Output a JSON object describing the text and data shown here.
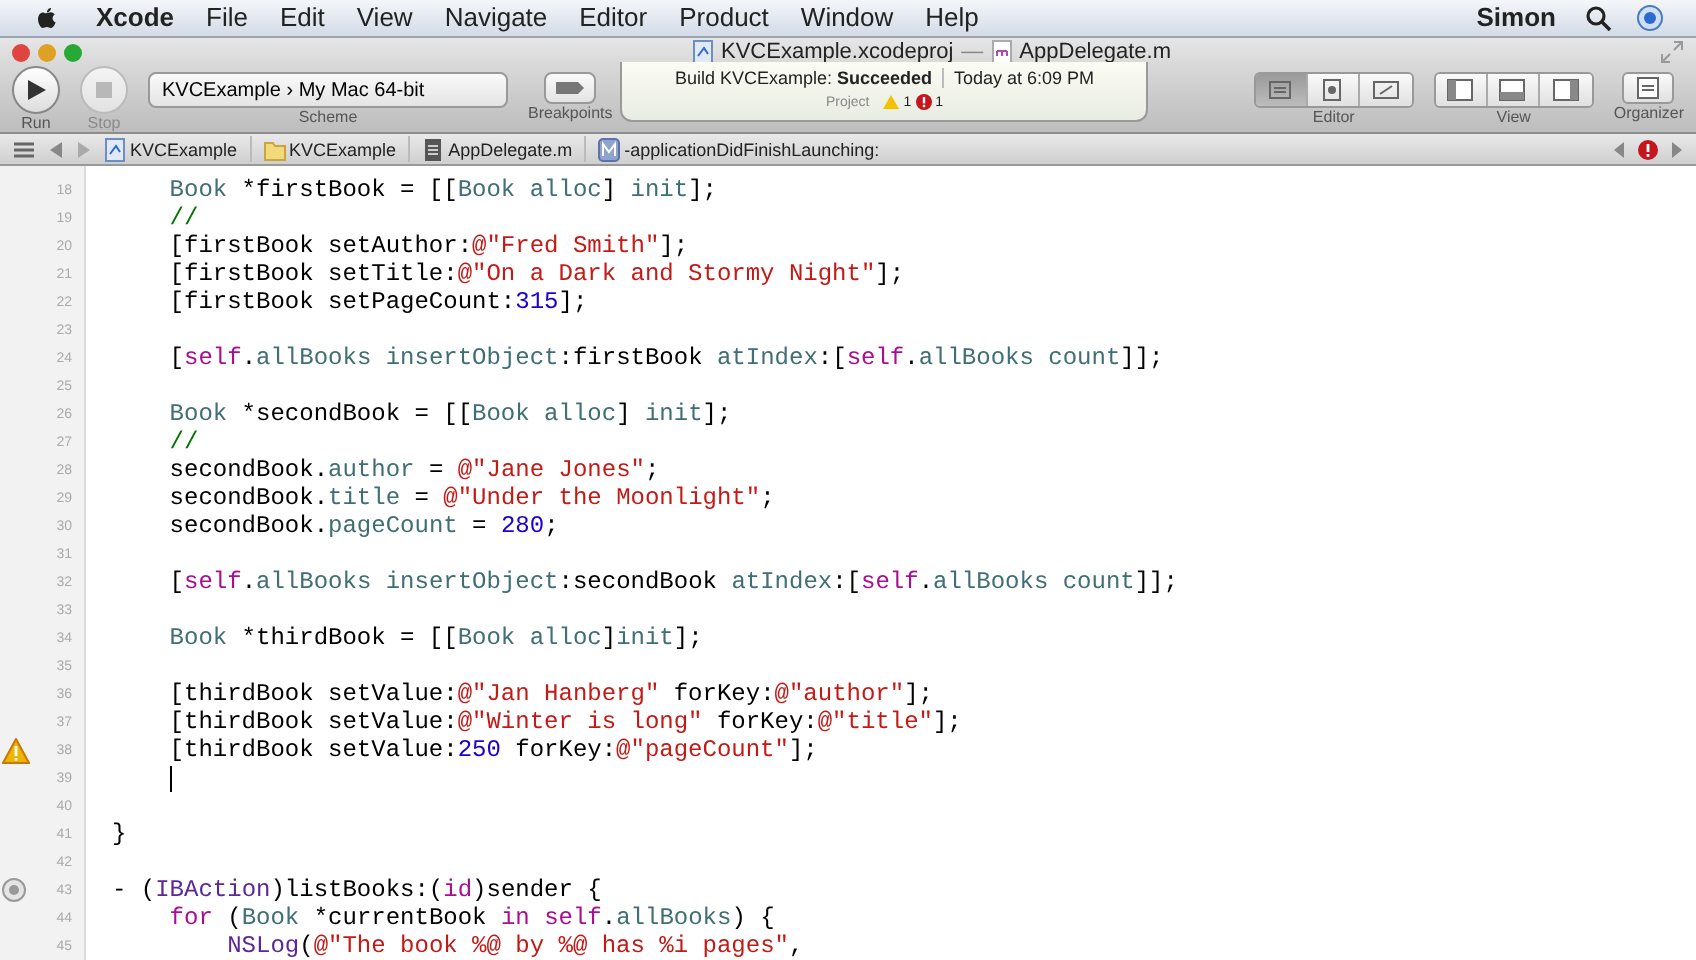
{
  "menu_bar": {
    "items": [
      {
        "label": "Xcode",
        "kind": "app"
      },
      {
        "label": "File",
        "kind": "menu"
      },
      {
        "label": "Edit",
        "kind": "menu"
      },
      {
        "label": "View",
        "kind": "menu"
      },
      {
        "label": "Navigate",
        "kind": "menu"
      },
      {
        "label": "Editor",
        "kind": "menu"
      },
      {
        "label": "Product",
        "kind": "menu"
      },
      {
        "label": "Window",
        "kind": "menu"
      },
      {
        "label": "Help",
        "kind": "menu"
      }
    ],
    "user": "Simon"
  },
  "window": {
    "title_project": "KVCExample.xcodeproj",
    "title_separator": "—",
    "title_file": "AppDelegate.m"
  },
  "toolbar": {
    "run": {
      "label": "Run",
      "disabled": false
    },
    "stop": {
      "label": "Stop",
      "disabled": true
    },
    "scheme": {
      "target": "KVCExample",
      "separator": "›",
      "destination": "My Mac 64-bit",
      "label": "Scheme"
    },
    "breakpoints": {
      "label": "Breakpoints"
    },
    "activity": {
      "prefix": "Build KVCExample:",
      "result": "Succeeded",
      "time": "Today at 6:09 PM",
      "project": "Project",
      "warnings": "1",
      "errors": "1"
    },
    "editor": {
      "label": "Editor",
      "segments": [
        {
          "selected": true
        },
        {
          "selected": false
        },
        {
          "selected": false
        }
      ]
    },
    "view": {
      "label": "View"
    },
    "organizer": {
      "label": "Organizer"
    }
  },
  "jump_bar": {
    "path": [
      {
        "label": "KVCExample",
        "kind": "project"
      },
      {
        "label": "KVCExample",
        "kind": "folder"
      },
      {
        "label": "AppDelegate.m",
        "kind": "file"
      },
      {
        "label": "-applicationDidFinishLaunching:",
        "kind": "method"
      }
    ]
  },
  "code": {
    "lines": [
      {
        "number": "18",
        "warning": false,
        "breakpoint": false,
        "caret": false,
        "tokens": [
          {
            "kind": "project",
            "text": "    Book"
          },
          {
            "kind": "plain",
            "text": " *firstBook = [["
          },
          {
            "kind": "project",
            "text": "Book"
          },
          {
            "kind": "project",
            "text": " alloc"
          },
          {
            "kind": "plain",
            "text": "] "
          },
          {
            "kind": "project",
            "text": "init"
          },
          {
            "kind": "plain",
            "text": "];"
          }
        ]
      },
      {
        "number": "19",
        "warning": false,
        "breakpoint": false,
        "caret": false,
        "tokens": [
          {
            "kind": "comment",
            "text": "    //"
          }
        ]
      },
      {
        "number": "20",
        "warning": false,
        "breakpoint": false,
        "caret": false,
        "tokens": [
          {
            "kind": "plain",
            "text": "    [firstBook setAuthor:"
          },
          {
            "kind": "string",
            "text": "@\"Fred Smith\""
          },
          {
            "kind": "plain",
            "text": "];"
          }
        ]
      },
      {
        "number": "21",
        "warning": false,
        "breakpoint": false,
        "caret": false,
        "tokens": [
          {
            "kind": "plain",
            "text": "    [firstBook setTitle:"
          },
          {
            "kind": "string",
            "text": "@\"On a Dark and Stormy Night\""
          },
          {
            "kind": "plain",
            "text": "];"
          }
        ]
      },
      {
        "number": "22",
        "warning": false,
        "breakpoint": false,
        "caret": false,
        "tokens": [
          {
            "kind": "plain",
            "text": "    [firstBook setPageCount:"
          },
          {
            "kind": "number",
            "text": "315"
          },
          {
            "kind": "plain",
            "text": "];"
          }
        ]
      },
      {
        "number": "23",
        "warning": false,
        "breakpoint": false,
        "caret": false
      },
      {
        "number": "24",
        "warning": false,
        "breakpoint": false,
        "caret": false,
        "tokens": [
          {
            "kind": "plain",
            "text": "    ["
          },
          {
            "kind": "keyword",
            "text": "self"
          },
          {
            "kind": "plain",
            "text": "."
          },
          {
            "kind": "project",
            "text": "allBooks"
          },
          {
            "kind": "project",
            "text": " insertObject"
          },
          {
            "kind": "plain",
            "text": ":firstBook "
          },
          {
            "kind": "project",
            "text": "atIndex"
          },
          {
            "kind": "plain",
            "text": ":["
          },
          {
            "kind": "keyword",
            "text": "self"
          },
          {
            "kind": "plain",
            "text": "."
          },
          {
            "kind": "project",
            "text": "allBooks"
          },
          {
            "kind": "project",
            "text": " count"
          },
          {
            "kind": "plain",
            "text": "]];"
          }
        ]
      },
      {
        "number": "25",
        "warning": false,
        "breakpoint": false,
        "caret": false
      },
      {
        "number": "26",
        "warning": false,
        "breakpoint": false,
        "caret": false,
        "tokens": [
          {
            "kind": "project",
            "text": "    Book"
          },
          {
            "kind": "plain",
            "text": " *secondBook = [["
          },
          {
            "kind": "project",
            "text": "Book"
          },
          {
            "kind": "project",
            "text": " alloc"
          },
          {
            "kind": "plain",
            "text": "] "
          },
          {
            "kind": "project",
            "text": "init"
          },
          {
            "kind": "plain",
            "text": "];"
          }
        ]
      },
      {
        "number": "27",
        "warning": false,
        "breakpoint": false,
        "caret": false,
        "tokens": [
          {
            "kind": "comment",
            "text": "    //"
          }
        ]
      },
      {
        "number": "28",
        "warning": false,
        "breakpoint": false,
        "caret": false,
        "tokens": [
          {
            "kind": "plain",
            "text": "    secondBook."
          },
          {
            "kind": "project",
            "text": "author"
          },
          {
            "kind": "plain",
            "text": " = "
          },
          {
            "kind": "string",
            "text": "@\"Jane Jones\""
          },
          {
            "kind": "plain",
            "text": ";"
          }
        ]
      },
      {
        "number": "29",
        "warning": false,
        "breakpoint": false,
        "caret": false,
        "tokens": [
          {
            "kind": "plain",
            "text": "    secondBook."
          },
          {
            "kind": "project",
            "text": "title"
          },
          {
            "kind": "plain",
            "text": " = "
          },
          {
            "kind": "string",
            "text": "@\"Under the Moonlight\""
          },
          {
            "kind": "plain",
            "text": ";"
          }
        ]
      },
      {
        "number": "30",
        "warning": false,
        "breakpoint": false,
        "caret": false,
        "tokens": [
          {
            "kind": "plain",
            "text": "    secondBook."
          },
          {
            "kind": "project",
            "text": "pageCount"
          },
          {
            "kind": "plain",
            "text": " = "
          },
          {
            "kind": "number",
            "text": "280"
          },
          {
            "kind": "plain",
            "text": ";"
          }
        ]
      },
      {
        "number": "31",
        "warning": false,
        "breakpoint": false,
        "caret": false
      },
      {
        "number": "32",
        "warning": false,
        "breakpoint": false,
        "caret": false,
        "tokens": [
          {
            "kind": "plain",
            "text": "    ["
          },
          {
            "kind": "keyword",
            "text": "self"
          },
          {
            "kind": "plain",
            "text": "."
          },
          {
            "kind": "project",
            "text": "allBooks"
          },
          {
            "kind": "project",
            "text": " insertObject"
          },
          {
            "kind": "plain",
            "text": ":secondBook "
          },
          {
            "kind": "project",
            "text": "atIndex"
          },
          {
            "kind": "plain",
            "text": ":["
          },
          {
            "kind": "keyword",
            "text": "self"
          },
          {
            "kind": "plain",
            "text": "."
          },
          {
            "kind": "project",
            "text": "allBooks"
          },
          {
            "kind": "project",
            "text": " count"
          },
          {
            "kind": "plain",
            "text": "]];"
          }
        ]
      },
      {
        "number": "33",
        "warning": false,
        "breakpoint": false,
        "caret": false
      },
      {
        "number": "34",
        "warning": false,
        "breakpoint": false,
        "caret": false,
        "tokens": [
          {
            "kind": "project",
            "text": "    Book"
          },
          {
            "kind": "plain",
            "text": " *thirdBook = [["
          },
          {
            "kind": "project",
            "text": "Book"
          },
          {
            "kind": "project",
            "text": " alloc"
          },
          {
            "kind": "plain",
            "text": "]"
          },
          {
            "kind": "project",
            "text": "init"
          },
          {
            "kind": "plain",
            "text": "];"
          }
        ]
      },
      {
        "number": "35",
        "warning": false,
        "breakpoint": false,
        "caret": false
      },
      {
        "number": "36",
        "warning": false,
        "breakpoint": false,
        "caret": false,
        "tokens": [
          {
            "kind": "plain",
            "text": "    [thirdBook setValue:"
          },
          {
            "kind": "string",
            "text": "@\"Jan Hanberg\""
          },
          {
            "kind": "plain",
            "text": " forKey:"
          },
          {
            "kind": "string",
            "text": "@\"author\""
          },
          {
            "kind": "plain",
            "text": "];"
          }
        ]
      },
      {
        "number": "37",
        "warning": false,
        "breakpoint": false,
        "caret": false,
        "tokens": [
          {
            "kind": "plain",
            "text": "    [thirdBook setValue:"
          },
          {
            "kind": "string",
            "text": "@\"Winter is long\""
          },
          {
            "kind": "plain",
            "text": " forKey:"
          },
          {
            "kind": "string",
            "text": "@\"title\""
          },
          {
            "kind": "plain",
            "text": "];"
          }
        ]
      },
      {
        "number": "38",
        "warning": true,
        "breakpoint": false,
        "caret": false,
        "tokens": [
          {
            "kind": "plain",
            "text": "    [thirdBook setValue:"
          },
          {
            "kind": "number",
            "text": "250"
          },
          {
            "kind": "plain",
            "text": " forKey:"
          },
          {
            "kind": "string",
            "text": "@\"pageCount\""
          },
          {
            "kind": "plain",
            "text": "];"
          }
        ]
      },
      {
        "number": "39",
        "warning": false,
        "breakpoint": false,
        "caret": true
      },
      {
        "number": "40",
        "warning": false,
        "breakpoint": false,
        "caret": false
      },
      {
        "number": "41",
        "warning": false,
        "breakpoint": false,
        "caret": false,
        "tokens": [
          {
            "kind": "plain",
            "text": "}"
          }
        ]
      },
      {
        "number": "42",
        "warning": false,
        "breakpoint": false,
        "caret": false
      },
      {
        "number": "43",
        "warning": false,
        "breakpoint": true,
        "caret": false,
        "tokens": [
          {
            "kind": "plain",
            "text": "- ("
          },
          {
            "kind": "system",
            "text": "IBAction"
          },
          {
            "kind": "plain",
            "text": ")listBooks:("
          },
          {
            "kind": "keyword",
            "text": "id"
          },
          {
            "kind": "plain",
            "text": ")sender {"
          }
        ]
      },
      {
        "number": "44",
        "warning": false,
        "breakpoint": false,
        "caret": false,
        "tokens": [
          {
            "kind": "keyword",
            "text": "    for"
          },
          {
            "kind": "plain",
            "text": " ("
          },
          {
            "kind": "project",
            "text": "Book"
          },
          {
            "kind": "plain",
            "text": " *currentBook "
          },
          {
            "kind": "keyword",
            "text": "in"
          },
          {
            "kind": "keyword",
            "text": " self"
          },
          {
            "kind": "plain",
            "text": "."
          },
          {
            "kind": "project",
            "text": "allBooks"
          },
          {
            "kind": "plain",
            "text": ") {"
          }
        ]
      },
      {
        "number": "45",
        "warning": false,
        "breakpoint": false,
        "caret": false,
        "tokens": [
          {
            "kind": "system",
            "text": "        NSLog"
          },
          {
            "kind": "plain",
            "text": "("
          },
          {
            "kind": "string",
            "text": "@\"The book %@ by %@ has %i pages\""
          },
          {
            "kind": "plain",
            "text": ","
          }
        ]
      }
    ]
  }
}
